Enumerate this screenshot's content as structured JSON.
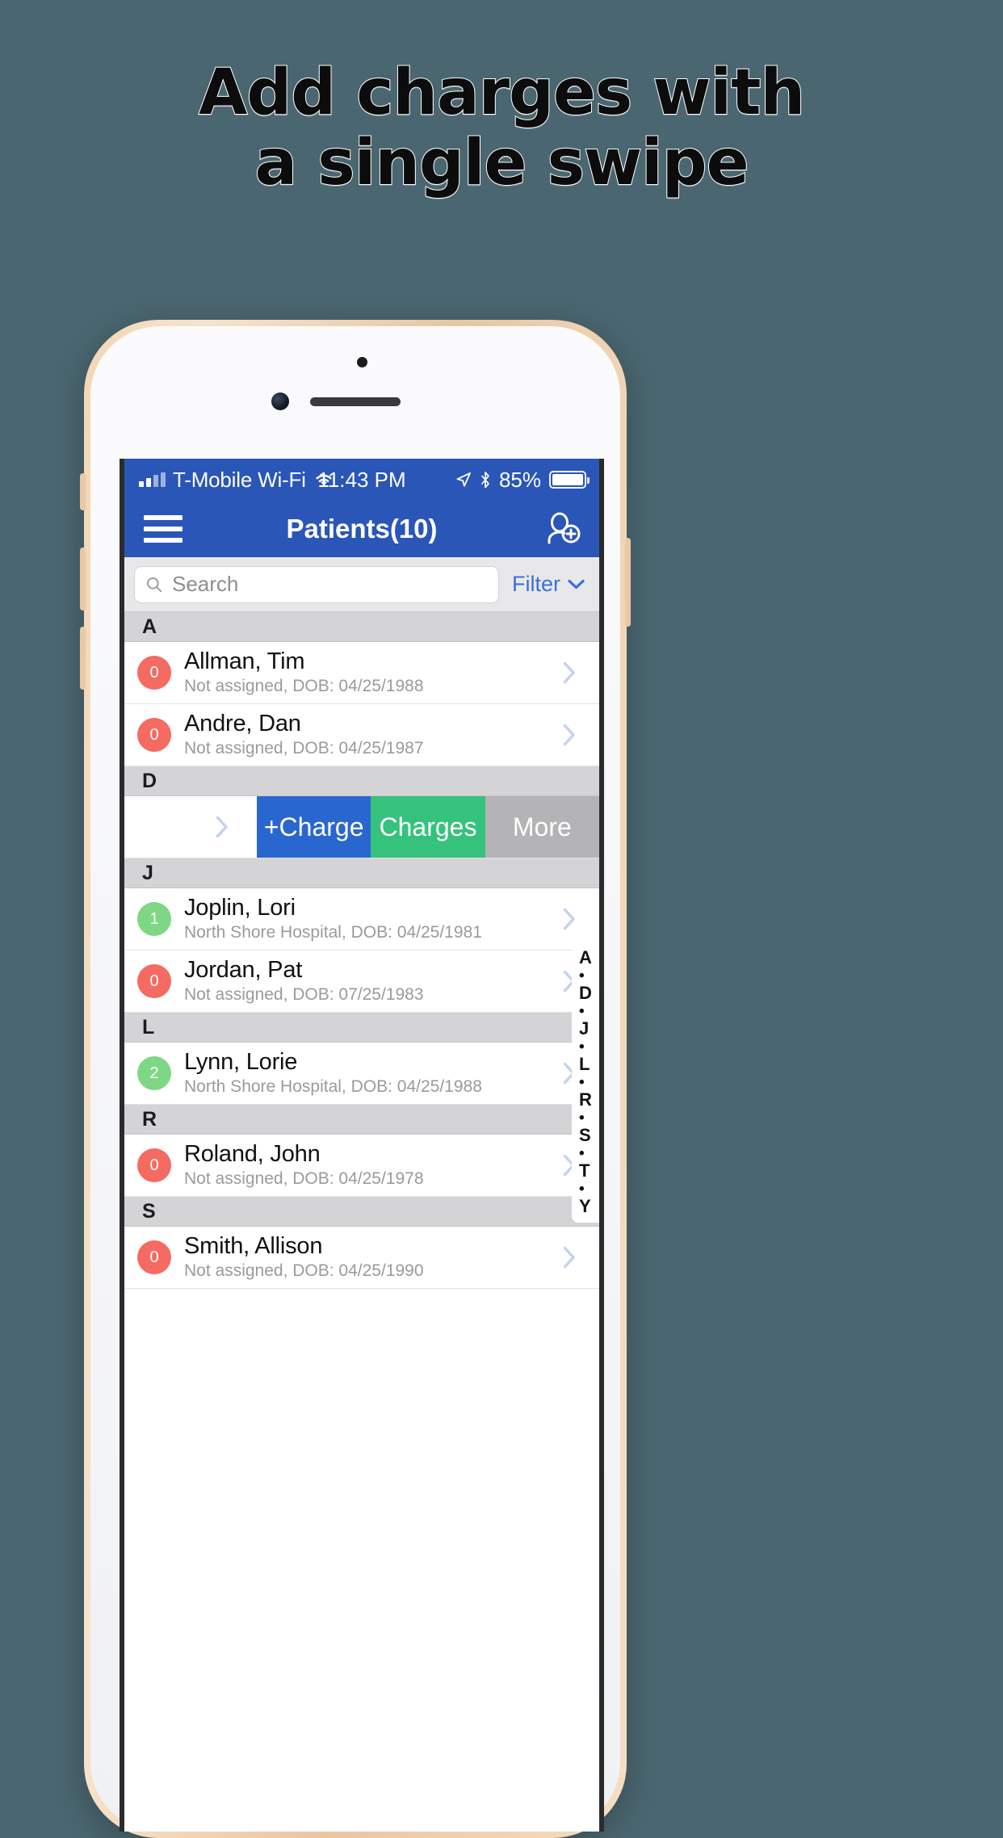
{
  "promo": {
    "headline_line1": "Add charges with",
    "headline_line2": "a single swipe",
    "background_color": "#4a6670"
  },
  "status_bar": {
    "carrier": "T-Mobile Wi-Fi",
    "time": "11:43 PM",
    "battery_percent": "85%",
    "icons": [
      "signal-bars-icon",
      "wifi-icon",
      "location-arrow-icon",
      "bluetooth-icon",
      "battery-icon"
    ]
  },
  "navbar": {
    "title": "Patients(10)",
    "menu_icon": "hamburger-menu-icon",
    "add_icon": "add-person-icon",
    "background_color": "#2a56b8"
  },
  "search": {
    "placeholder": "Search",
    "icon": "search-icon",
    "filter_label": "Filter",
    "filter_chevron": "chevron-down-icon",
    "filter_color": "#3a6fd8"
  },
  "swipe_actions": {
    "add_charge": "+Charge",
    "charges": "Charges",
    "more": "More",
    "add_charge_color": "#2a66d0",
    "charges_color": "#35c27c",
    "more_color": "#b4b4b6"
  },
  "list": {
    "sections": [
      {
        "letter": "A",
        "rows": [
          {
            "badge": "0",
            "badge_color": "red",
            "name": "Allman, Tim",
            "sub": "Not assigned, DOB: 04/25/1988"
          },
          {
            "badge": "0",
            "badge_color": "red",
            "name": "Andre, Dan",
            "sub": "Not assigned, DOB: 04/25/1987"
          }
        ]
      },
      {
        "letter": "D",
        "rows": []
      },
      {
        "letter": "J",
        "rows": [
          {
            "badge": "1",
            "badge_color": "green",
            "name": "Joplin, Lori",
            "sub": "North Shore Hospital, DOB: 04/25/1981"
          },
          {
            "badge": "0",
            "badge_color": "red",
            "name": "Jordan, Pat",
            "sub": "Not assigned, DOB: 07/25/1983"
          }
        ]
      },
      {
        "letter": "L",
        "rows": [
          {
            "badge": "2",
            "badge_color": "green",
            "name": "Lynn, Lorie",
            "sub": "North Shore Hospital, DOB: 04/25/1988"
          }
        ]
      },
      {
        "letter": "R",
        "rows": [
          {
            "badge": "0",
            "badge_color": "red",
            "name": "Roland, John",
            "sub": "Not assigned, DOB: 04/25/1978"
          }
        ]
      },
      {
        "letter": "S",
        "rows": [
          {
            "badge": "0",
            "badge_color": "red",
            "name": "Smith, Allison",
            "sub": "Not assigned, DOB: 04/25/1990"
          }
        ]
      }
    ]
  },
  "index_bar": {
    "entries": [
      "A",
      "•",
      "D",
      "•",
      "J",
      "•",
      "L",
      "•",
      "R",
      "•",
      "S",
      "•",
      "T",
      "•",
      "Y"
    ]
  }
}
